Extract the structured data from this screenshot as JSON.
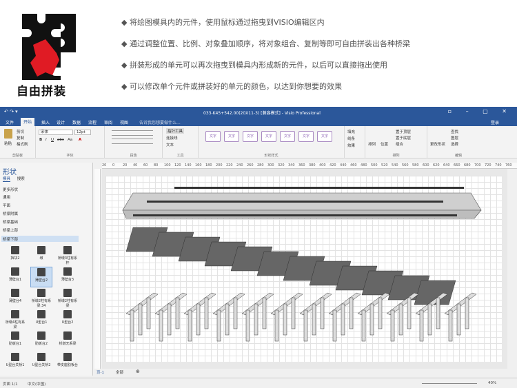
{
  "promo": {
    "title": "自由拼装",
    "bullets": [
      "◆ 将绘图模具内的元件，使用鼠标通过拖曳到VISIO编辑区内",
      "◆ 通过调整位置、比例、对象叠加顺序，将对象组合、复制等即可自由拼装出各种桥梁",
      "◆ 拼装形成的单元可以再次拖曳到模具内形成新的元件，以后可以直接拖出使用",
      "◆ 可以修改单个元件或拼装好的单元的颜色，以达到你想要的效果"
    ]
  },
  "app": {
    "title": "033-K45+542.00(20X11-3) [兼容模式] - Visio Professional",
    "tabs": [
      "文件",
      "开始",
      "插入",
      "设计",
      "数据",
      "流程",
      "审阅",
      "视图"
    ],
    "active_tab": "开始",
    "tell_me": "告诉我您想要做什么...",
    "login": "登录",
    "accent": "#2b579a"
  },
  "ribbon": {
    "clipboard": {
      "paste": "粘贴",
      "cut": "剪切",
      "copy": "复制",
      "format": "格式刷",
      "label": "剪贴板"
    },
    "font": {
      "name": "宋体",
      "size": "12pt",
      "label": "字体",
      "buttons": [
        "B",
        "I",
        "U",
        "abc",
        "Aa",
        "A"
      ]
    },
    "paragraph": {
      "label": "段落"
    },
    "tools": {
      "pointer": "指针工具",
      "connector": "连接线",
      "text": "文本",
      "label": "工具"
    },
    "shape_styles": {
      "items": [
        "文字",
        "文字",
        "文字",
        "文字",
        "文字",
        "文字",
        "文字"
      ],
      "label": "形状样式"
    },
    "shape_format": {
      "fill": "填充",
      "line": "线条",
      "effect": "效果"
    },
    "arrange": {
      "align": "排列",
      "position": "位置",
      "front": "置于顶层",
      "back": "置于底层",
      "group": "组合",
      "label": "排列"
    },
    "edit": {
      "find": "查找",
      "layer": "图层",
      "select": "选择",
      "change_shape": "更改形状",
      "label": "编辑"
    }
  },
  "sidebar": {
    "title": "形状",
    "tabs": [
      "模具",
      "搜索"
    ],
    "categories": [
      "更多形状",
      "通用",
      "平面",
      "桥梁附属",
      "桥梁基础",
      "桥梁上部",
      "桥梁下部"
    ],
    "selected_category": "桥梁下部",
    "stencils": [
      "挡块2",
      "墩",
      "桥墩3柱有系杆",
      "薄壁台1",
      "薄壁台2",
      "薄壁台3",
      "薄壁台4",
      "桥墩2柱有系梁.34",
      "桥墩2柱有系梁",
      "桥墩4柱有系梁",
      "U型台1",
      "U型台2",
      "肋板台1",
      "肋板台2",
      "桥墩无系梁",
      "U型台关桥1",
      "U型台关桥2",
      "带支座肋板台"
    ],
    "selected_stencil": "薄壁台2"
  },
  "ruler": {
    "marks": [
      "20",
      "0",
      "20",
      "40",
      "60",
      "80",
      "100",
      "120",
      "140",
      "160",
      "180",
      "200",
      "220",
      "240",
      "260",
      "280",
      "300",
      "320",
      "340",
      "360",
      "380",
      "400",
      "420",
      "440",
      "460",
      "480",
      "500",
      "520",
      "540",
      "560",
      "580",
      "600",
      "620",
      "640",
      "660",
      "680",
      "700",
      "720",
      "740",
      "760"
    ]
  },
  "pages": {
    "current": "页-1",
    "all": "全部"
  },
  "status": {
    "page": "页面 1/1",
    "lang": "中文(中国)",
    "zoom": "40%"
  }
}
